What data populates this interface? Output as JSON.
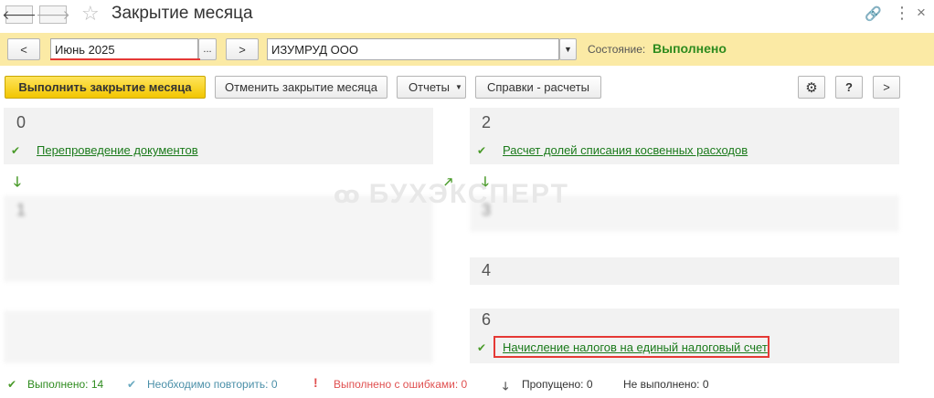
{
  "window": {
    "title": "Закрытие месяца",
    "nav": {
      "back_icon": "arrow-left-icon",
      "forward_icon": "arrow-right-icon",
      "favorite_icon": "star-icon"
    },
    "actions": {
      "link_icon": "link-icon",
      "more_icon": "more-vertical-icon",
      "close_icon": "close-icon"
    }
  },
  "params": {
    "prev_label": "<",
    "period_value": "Июнь 2025",
    "period_select_label": "...",
    "next_label": ">",
    "organization_value": "ИЗУМРУД ООО",
    "status_label": "Состояние:",
    "status_value": "Выполнено"
  },
  "toolbar": {
    "run_label": "Выполнить закрытие месяца",
    "cancel_label": "Отменить закрытие месяца",
    "reports_label": "Отчеты",
    "references_label": "Справки - расчеты",
    "help_label": "?",
    "more_label": ">"
  },
  "steps": {
    "step0": {
      "number": "0",
      "item": "Перепроведение документов"
    },
    "step1": {
      "number": "1"
    },
    "step2": {
      "number": "2",
      "item": "Расчет долей списания косвенных расходов"
    },
    "step3": {
      "number": "3"
    },
    "step4": {
      "number": "4"
    },
    "step6": {
      "number": "6",
      "item": "Начисление налогов на единый налоговый счет"
    }
  },
  "watermark": "БУХЭКСПЕРТ",
  "summary": {
    "done_label": "Выполнено:",
    "done_count": "14",
    "repeat_label": "Необходимо повторить:",
    "repeat_count": "0",
    "errors_label": "Выполнено с ошибками:",
    "errors_count": "0",
    "skipped_label": "Пропущено:",
    "skipped_count": "0",
    "notdone_label": "Не выполнено:",
    "notdone_count": "0"
  },
  "colors": {
    "accent_yellow": "#f2c600",
    "panel_yellow": "#fbeaa5",
    "success_green": "#2e8b1e",
    "error_red": "#e05050",
    "repeat_teal": "#4a8fa8"
  }
}
